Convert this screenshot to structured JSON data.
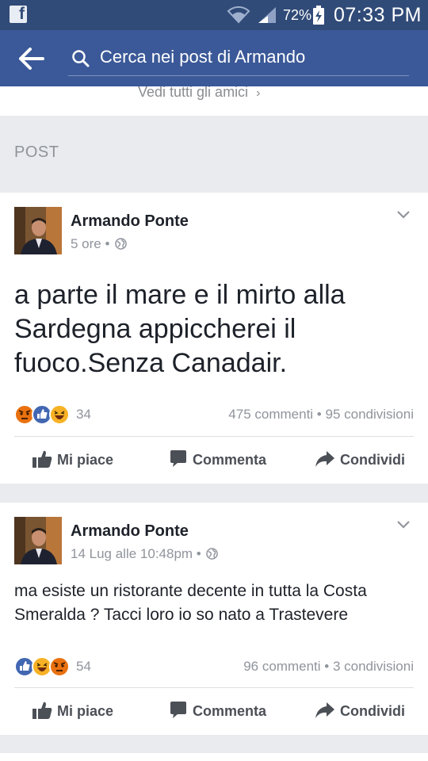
{
  "status_bar": {
    "battery": "72%",
    "time": "07:33 PM"
  },
  "search": {
    "placeholder": "Cerca nei post di Armando"
  },
  "friends": {
    "see_all": "Vedi tutti gli amici"
  },
  "section": {
    "title": "POST"
  },
  "posts": [
    {
      "author": "Armando Ponte",
      "time": "5 ore",
      "text": "a parte il mare e il mirto alla Sardegna appiccherei il fuoco.Senza Canadair.",
      "reactions": [
        "angry",
        "like",
        "haha"
      ],
      "reaction_count": "34",
      "comments": "475 commenti",
      "shares": "95 condivisioni"
    },
    {
      "author": "Armando Ponte",
      "time": "14 Lug alle 10:48pm",
      "text": "ma esiste un ristorante decente in tutta la Costa Smeralda ? Tacci loro io so nato a Trastevere",
      "reactions": [
        "like",
        "haha",
        "angry"
      ],
      "reaction_count": "54",
      "comments": "96 commenti",
      "shares": "3 condivisioni"
    }
  ],
  "actions": {
    "like": "Mi piace",
    "comment": "Commenta",
    "share": "Condividi"
  },
  "colors": {
    "brand": "#3b5998",
    "status_bar": "#314b78",
    "like_blue": "#4267b2",
    "angry_orange": "#e9710f",
    "haha_yellow": "#f7b125"
  }
}
